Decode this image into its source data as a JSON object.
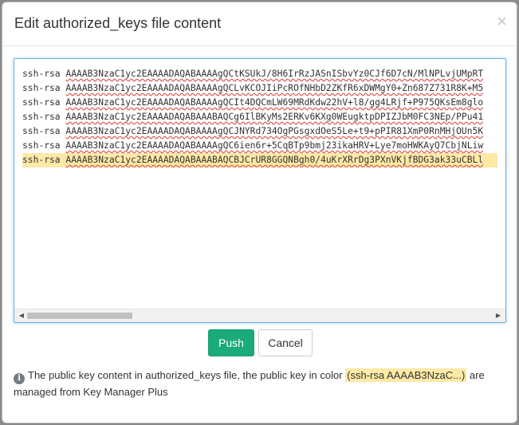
{
  "dialog": {
    "title": "Edit authorized_keys file content",
    "close_glyph": "×"
  },
  "editor": {
    "lines": [
      {
        "type": "ssh-rsa",
        "key": "AAAAB3NzaC1yc2EAAAADAQABAAAAgQCtKSUkJ/8H6IrRzJASnISbvYz0CJf6D7cN/MlNPLvjUMpRT",
        "managed": false
      },
      {
        "type": "ssh-rsa",
        "key": "AAAAB3NzaC1yc2EAAAADAQABAAAAgQCLvKCOJIiPcROfNHbD2ZKfR6xDWMgY0+Zn687Z731R8K+M5",
        "managed": false
      },
      {
        "type": "ssh-rsa",
        "key": "AAAAB3NzaC1yc2EAAAADAQABAAAAgQCIt4DQCmLW69MRdKdw22hV+l8/gg4LRjf+P975QKsEm8glo",
        "managed": false
      },
      {
        "type": "ssh-rsa",
        "key": "AAAAB3NzaC1yc2EAAAADAQABAAABAQCg6IlBKyMs2ERKv6KXg0WEugktpDPIZJbM0FC3NEp/PPu41",
        "managed": false
      },
      {
        "type": "ssh-rsa",
        "key": "AAAAB3NzaC1yc2EAAAADAQABAAAAgQCJNYRd734OgPGsgxdOeS5Le+t9+pPIR81XmP0RnMHjOUn5K",
        "managed": false
      },
      {
        "type": "ssh-rsa",
        "key": "AAAAB3NzaC1yc2EAAAADAQABAAAAgQC6ien6r+5CqBTp9bmj23ikaHRV+Lye7moHWKAyQ7CbjNLiw",
        "managed": false
      },
      {
        "type": "ssh-rsa",
        "key": "AAAAB3NzaC1yc2EAAAADAQABAAABAQCBJCrUR8GGQNBgh0/4uKrXRrDg3PXnVKjfBDG3ak33uCBLl",
        "managed": true
      }
    ]
  },
  "buttons": {
    "push": "Push",
    "cancel": "Cancel"
  },
  "info": {
    "icon": "i",
    "text_before": "The public key content in authorized_keys file, the public key in color ",
    "highlight_sample": "(ssh-rsa AAAAB3NzaC...)",
    "text_after": " are managed from Key Manager Plus"
  },
  "colors": {
    "primary": "#1aaa7c",
    "managed_highlight": "#fde9a6",
    "focus_border": "#66afe9"
  }
}
